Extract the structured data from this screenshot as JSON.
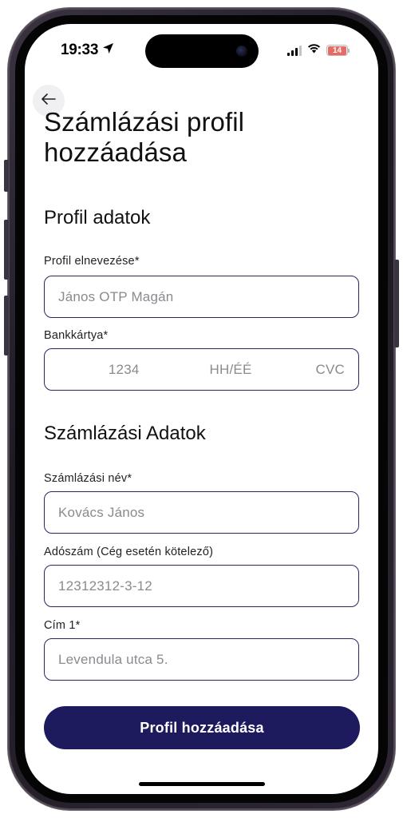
{
  "status_bar": {
    "time": "19:33",
    "battery_level": "14",
    "battery_color": "#e5483f"
  },
  "header": {
    "back_icon": "arrow-left-icon",
    "title": "Számlázási profil hozzáadása"
  },
  "profile_section": {
    "title": "Profil adatok",
    "profile_name": {
      "label": "Profil elnevezése*",
      "placeholder": "János OTP Magán",
      "value": ""
    },
    "bank_card": {
      "label": "Bankkártya*",
      "number_placeholder": "1234",
      "expiry_placeholder": "HH/ÉÉ",
      "cvc_placeholder": "CVC"
    }
  },
  "billing_section": {
    "title": "Számlázási Adatok",
    "billing_name": {
      "label": "Számlázási név*",
      "placeholder": "Kovács János",
      "value": ""
    },
    "tax_number": {
      "label": "Adószám (Cég esetén kötelező)",
      "placeholder": "12312312-3-12",
      "value": ""
    },
    "address1": {
      "label": "Cím 1*",
      "placeholder": "Levendula utca 5.",
      "value": ""
    }
  },
  "actions": {
    "submit_label": "Profil hozzáadása"
  },
  "colors": {
    "accent": "#1d1a5e",
    "field_border": "#2a2560",
    "placeholder": "#8a8a90"
  }
}
